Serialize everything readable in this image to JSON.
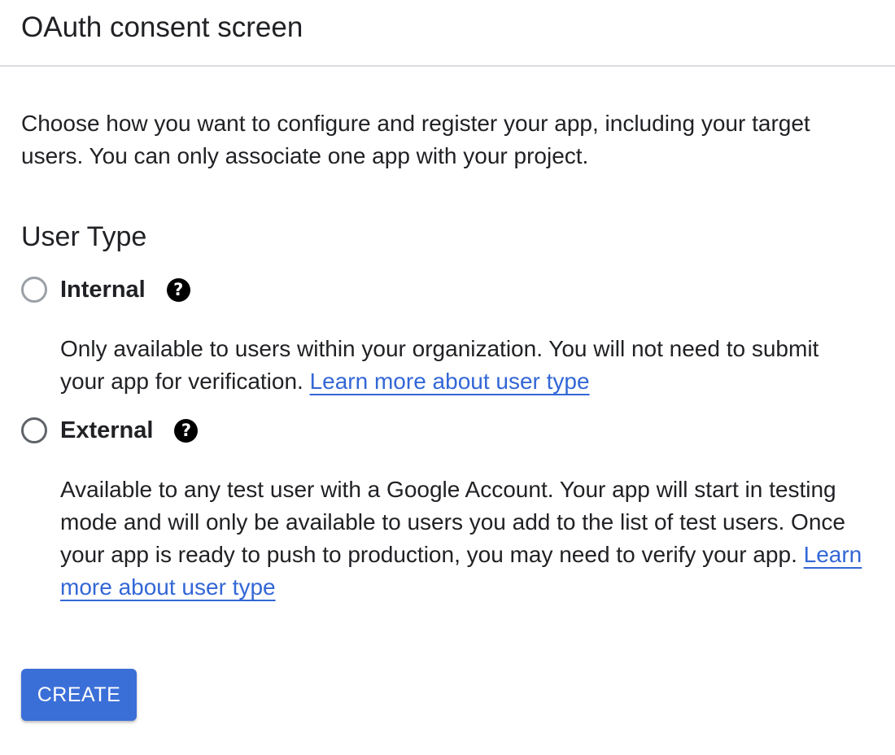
{
  "header": {
    "title": "OAuth consent screen"
  },
  "intro": {
    "text": "Choose how you want to configure and register your app, including your target users. You can only associate one app with your project."
  },
  "user_type": {
    "title": "User Type",
    "options": [
      {
        "label": "Internal",
        "selected": false,
        "description": "Only available to users within your organization. You will not need to submit your app for verification.",
        "link": "Learn more about user type",
        "help_icon": "help-icon"
      },
      {
        "label": "External",
        "selected": false,
        "description": "Available to any test user with a Google Account. Your app will start in testing mode and will only be available to users you add to the list of test users. Once your app is ready to push to production, you may need to verify your app.",
        "link": "Learn more about user type",
        "help_icon": "help-icon"
      }
    ]
  },
  "actions": {
    "create_label": "CREATE"
  },
  "colors": {
    "link": "#3367d6",
    "button": "#3b6fd8",
    "divider": "#dadce0"
  }
}
